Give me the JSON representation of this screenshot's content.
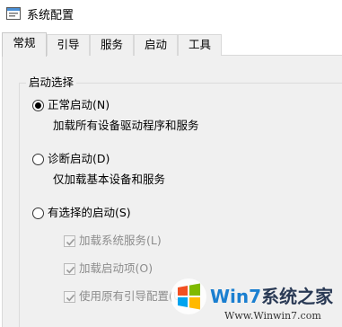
{
  "window": {
    "title": "系统配置"
  },
  "tabs": [
    {
      "label": "常规",
      "active": true
    },
    {
      "label": "引导",
      "active": false
    },
    {
      "label": "服务",
      "active": false
    },
    {
      "label": "启动",
      "active": false
    },
    {
      "label": "工具",
      "active": false
    }
  ],
  "startup_selection": {
    "group_title": "启动选择",
    "normal": {
      "label": "正常启动(N)",
      "description": "加载所有设备驱动程序和服务",
      "selected": true
    },
    "diagnostic": {
      "label": "诊断启动(D)",
      "description": "仅加载基本设备和服务",
      "selected": false
    },
    "selective": {
      "label": "有选择的启动(S)",
      "selected": false,
      "options": [
        {
          "label": "加载系统服务(L)",
          "checked": true,
          "enabled": false
        },
        {
          "label": "加载启动项(O)",
          "checked": true,
          "enabled": false
        },
        {
          "label": "使用原有引导配置(U)",
          "checked": true,
          "enabled": false
        }
      ]
    }
  },
  "watermark": {
    "brand_part1": "Win7",
    "brand_part2": "系统之家",
    "url": "Www.Winwin7.com"
  }
}
